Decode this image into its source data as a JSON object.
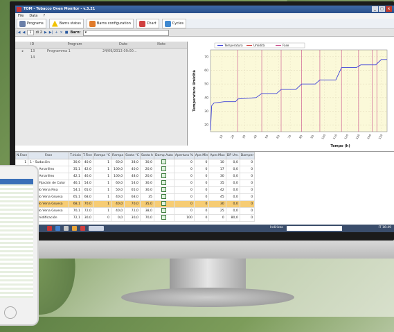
{
  "window": {
    "title": "TOM - Tobacco Oven Monitor - v.3.21"
  },
  "menu": [
    "File",
    "Data",
    "?"
  ],
  "toolbar": {
    "items": [
      "Programs",
      "Barns status",
      "Barns configuration",
      "Chart",
      "Cycles"
    ]
  },
  "navigator": {
    "record": "1",
    "of": "di 2",
    "barn_label": "Barn:"
  },
  "programs_grid": {
    "columns": [
      "ID",
      "Program",
      "Date",
      "Note"
    ],
    "rows": [
      {
        "id": "13",
        "program": "Programma 1",
        "date": "24/09/2013 09:00..."
      },
      {
        "id": "14",
        "program": "",
        "date": ""
      }
    ]
  },
  "chart_data": {
    "type": "line",
    "legend": [
      "Temperatura",
      "Umidità",
      "Fase"
    ],
    "xlabel": "Tempo (h)",
    "ylabel": "Temperatura Umidità",
    "ylim": [
      15,
      75
    ],
    "yticks": [
      20,
      30,
      40,
      50,
      60,
      70
    ],
    "xlim": [
      0,
      155
    ],
    "xticks": [
      10,
      20,
      30,
      40,
      50,
      60,
      70,
      80,
      90,
      100,
      110,
      120,
      130,
      140,
      150
    ],
    "grid": true,
    "series": [
      {
        "name": "Temperatura",
        "color": "#3b3fd9",
        "x": [
          0,
          1,
          3,
          12,
          22,
          24,
          40,
          45,
          58,
          62,
          75,
          80,
          92,
          96,
          110,
          115,
          128,
          132,
          145,
          150,
          155
        ],
        "y": [
          16,
          34,
          36,
          37,
          37,
          39,
          40,
          43,
          43,
          46,
          46,
          50,
          50,
          53,
          53,
          62,
          62,
          64,
          64,
          68,
          68
        ]
      }
    ],
    "phase_markers": [
      24,
      45,
      62,
      80,
      96,
      115,
      130,
      142,
      146
    ],
    "colors": {
      "temperatura": "#3b3fd9",
      "umidita": "#d04040",
      "fase": "#c84a8a",
      "plot_bg": "#fbf9d9"
    }
  },
  "phases": {
    "columns": [
      "N.Fase",
      "Fase",
      "T.Inizio",
      "T.Fine",
      "Rampa °C",
      "Rampa",
      "Sosta °C",
      "Sosta h",
      "Damp.Auto",
      "Apertura %",
      "Ape.Min",
      "Aper.Max",
      "DP Um.",
      "Damper"
    ],
    "rows": [
      [
        "1",
        "1 - Sudación",
        "30,0",
        "40,0",
        "1",
        "60,0",
        "38,0",
        "30,0",
        "✓",
        "0",
        "0",
        "10",
        "0,0",
        "0"
      ],
      [
        "",
        "Fase: Amarilleo",
        "35,1",
        "42,0",
        "1",
        "100,0",
        "40,0",
        "20,0",
        "✓",
        "0",
        "0",
        "17",
        "0,0",
        "0"
      ],
      [
        "",
        "Fase: Amarilleo",
        "42,1",
        "46,0",
        "1",
        "100,0",
        "48,0",
        "20,0",
        "✓",
        "0",
        "0",
        "30",
        "0,0",
        "0"
      ],
      [
        "",
        "Fase: Fijación de Color",
        "46,1",
        "54,0",
        "1",
        "60,0",
        "54,0",
        "30,0",
        "✓",
        "0",
        "0",
        "35",
        "0,0",
        "0"
      ],
      [
        "",
        "Secado Vena Fina",
        "54,1",
        "65,0",
        "1",
        "50,0",
        "65,0",
        "30,0",
        "✓",
        "0",
        "0",
        "42",
        "0,0",
        "0"
      ],
      [
        "",
        "Secado Vena Gruesa",
        "65,1",
        "68,0",
        "1",
        "40,0",
        "68,0",
        "35",
        "✓",
        "0",
        "0",
        "45",
        "0,0",
        "0"
      ],
      [
        "",
        "Secado Vena Gruesa",
        "68,1",
        "70,0",
        "1",
        "40,0",
        "70,0",
        "35,0",
        "✓",
        "0",
        "0",
        "30",
        "0,0",
        "0"
      ],
      [
        "",
        "Secado Vena Gruesa",
        "70,1",
        "72,0",
        "1",
        "40,0",
        "72,0",
        "38,0",
        "✓",
        "0",
        "0",
        "25",
        "0,0",
        "0"
      ],
      [
        "",
        "Rehumidificación",
        "72,1",
        "30,0",
        "0",
        "0,0",
        "30,0",
        "70,0",
        "✓",
        "100",
        "0",
        "0",
        "80,0",
        "0"
      ]
    ],
    "selected_row": 6
  },
  "taskbar": {
    "address_label": "Indirizzo",
    "lang": "IT",
    "clock": "16:49"
  }
}
